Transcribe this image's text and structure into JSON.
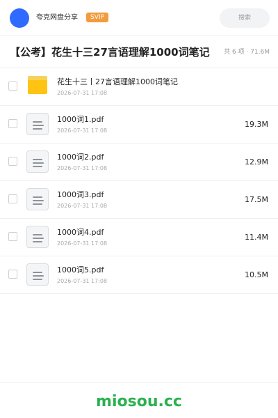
{
  "header": {
    "share_name": "夸克网盘分享",
    "badge": "SVIP",
    "search_placeholder": "搜索"
  },
  "title_bar": {
    "title": "【公考】花生十三27言语理解1000词笔记",
    "count": "共 6 项",
    "separator": "·",
    "total_size": "71.6M"
  },
  "files": [
    {
      "type": "folder",
      "name": "花生十三丨27言语理解1000词笔记",
      "date": "2026-07-31 17:08",
      "size": ""
    },
    {
      "type": "pdf",
      "name": "1000词1.pdf",
      "date": "2026-07-31 17:08",
      "size": "19.3M"
    },
    {
      "type": "pdf",
      "name": "1000词2.pdf",
      "date": "2026-07-31 17:08",
      "size": "12.9M"
    },
    {
      "type": "pdf",
      "name": "1000词3.pdf",
      "date": "2026-07-31 17:08",
      "size": "17.5M"
    },
    {
      "type": "pdf",
      "name": "1000词4.pdf",
      "date": "2026-07-31 17:08",
      "size": "11.4M"
    },
    {
      "type": "pdf",
      "name": "1000词5.pdf",
      "date": "2026-07-31 17:08",
      "size": "10.5M"
    }
  ],
  "footer": {
    "brand": "miosou.cc"
  },
  "colors": {
    "avatar": "#2f6bff",
    "badge": "#f39c3d",
    "folder": "#ffc413",
    "brand": "#2bb150"
  }
}
